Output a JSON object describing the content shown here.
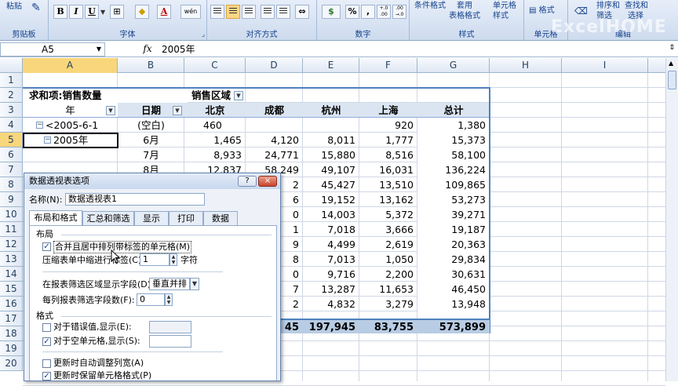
{
  "ribbon": {
    "clipboard": {
      "paste": "粘贴",
      "group_label": "剪贴板"
    },
    "font": {
      "bold": "B",
      "italic": "I",
      "underline": "U",
      "font_color_glyph": "A",
      "phonetic": "wén",
      "group_label": "字体"
    },
    "alignment": {
      "group_label": "对齐方式"
    },
    "number": {
      "percent": "%",
      "comma": ",",
      "inc_decimal": "+.0 .00",
      "dec_decimal": ".00 →.0",
      "group_label": "数字"
    },
    "styles": {
      "conditional": "条件格式",
      "table_format_1": "套用",
      "table_format_2": "表格格式",
      "cell_style_1": "单元格",
      "cell_style_2": "样式",
      "group_label": "样式"
    },
    "cells": {
      "format": "格式",
      "group_label": "单元格"
    },
    "editing": {
      "sort_1": "排序和",
      "sort_2": "筛选",
      "find_1": "查找和",
      "find_2": "选择",
      "group_label": "编辑"
    },
    "watermark": "ExcelHOME"
  },
  "formula_bar": {
    "name_box": "A5",
    "fx": "fx",
    "content": "2005年"
  },
  "columns": [
    "A",
    "B",
    "C",
    "D",
    "E",
    "F",
    "G",
    "H",
    "I"
  ],
  "rows": [
    "1",
    "2",
    "3",
    "4",
    "5",
    "6",
    "7",
    "8",
    "9",
    "10",
    "11",
    "12",
    "13",
    "14",
    "15",
    "16",
    "17",
    "18",
    "19",
    "20"
  ],
  "pivot": {
    "title": "求和项:销售数量",
    "area_label": "销售区域",
    "year_header": "年",
    "date_header": "日期",
    "cities": [
      "北京",
      "成都",
      "杭州",
      "上海",
      "总计"
    ],
    "group_1": "<2005-6-1",
    "group_2": "2005年",
    "data_rows": [
      {
        "date": "(空白)",
        "v": [
          "460",
          "",
          "",
          "920",
          "1,380"
        ]
      },
      {
        "date": "6月",
        "v": [
          "1,465",
          "4,120",
          "8,011",
          "1,777",
          "15,373"
        ]
      },
      {
        "date": "7月",
        "v": [
          "8,933",
          "24,771",
          "15,880",
          "8,516",
          "58,100"
        ]
      },
      {
        "date": "8月",
        "v": [
          "12,837",
          "58,249",
          "49,107",
          "16,031",
          "136,224"
        ]
      },
      {
        "date": "",
        "v": [
          "",
          "2",
          "45,427",
          "13,510",
          "109,865"
        ]
      },
      {
        "date": "",
        "v": [
          "",
          "6",
          "19,152",
          "13,162",
          "53,273"
        ]
      },
      {
        "date": "",
        "v": [
          "",
          "0",
          "14,003",
          "5,372",
          "39,271"
        ]
      },
      {
        "date": "",
        "v": [
          "",
          "1",
          "7,018",
          "3,666",
          "19,187"
        ]
      },
      {
        "date": "",
        "v": [
          "",
          "9",
          "4,499",
          "2,619",
          "20,363"
        ]
      },
      {
        "date": "",
        "v": [
          "",
          "8",
          "7,013",
          "1,050",
          "29,834"
        ]
      },
      {
        "date": "",
        "v": [
          "",
          "0",
          "9,716",
          "2,200",
          "30,631"
        ]
      },
      {
        "date": "",
        "v": [
          "",
          "7",
          "13,287",
          "11,653",
          "46,450"
        ]
      },
      {
        "date": "",
        "v": [
          "",
          "2",
          "4,832",
          "3,279",
          "13,948"
        ]
      }
    ],
    "total_row": [
      "45",
      "197,945",
      "83,755",
      "573,899"
    ]
  },
  "dialog": {
    "title": "数据透视表选项",
    "help": "?",
    "close": "×",
    "name_label": "名称(N):",
    "name_value": "数据透视表1",
    "tabs": [
      "布局和格式",
      "汇总和筛选",
      "显示",
      "打印",
      "数据"
    ],
    "layout_heading": "布局",
    "merge_center": "合并且居中排列带标签的单元格(M)",
    "merge_checked": true,
    "indent_label": "压缩表单中缩进行标签(C):",
    "indent_value": "1",
    "indent_unit": "字符",
    "filter_area_label": "在报表筛选区域显示字段(D):",
    "filter_area_value": "垂直并排",
    "fields_per_col_label": "每列报表筛选字段数(F):",
    "fields_per_col_value": "0",
    "format_heading": "格式",
    "error_label": "对于错误值,显示(E):",
    "error_checked": false,
    "empty_label": "对于空单元格,显示(S):",
    "empty_checked": true,
    "autofit_label": "更新时自动调整列宽(A)",
    "autofit_checked": false,
    "preserve_label": "更新时保留单元格格式(P)",
    "preserve_checked": true
  }
}
